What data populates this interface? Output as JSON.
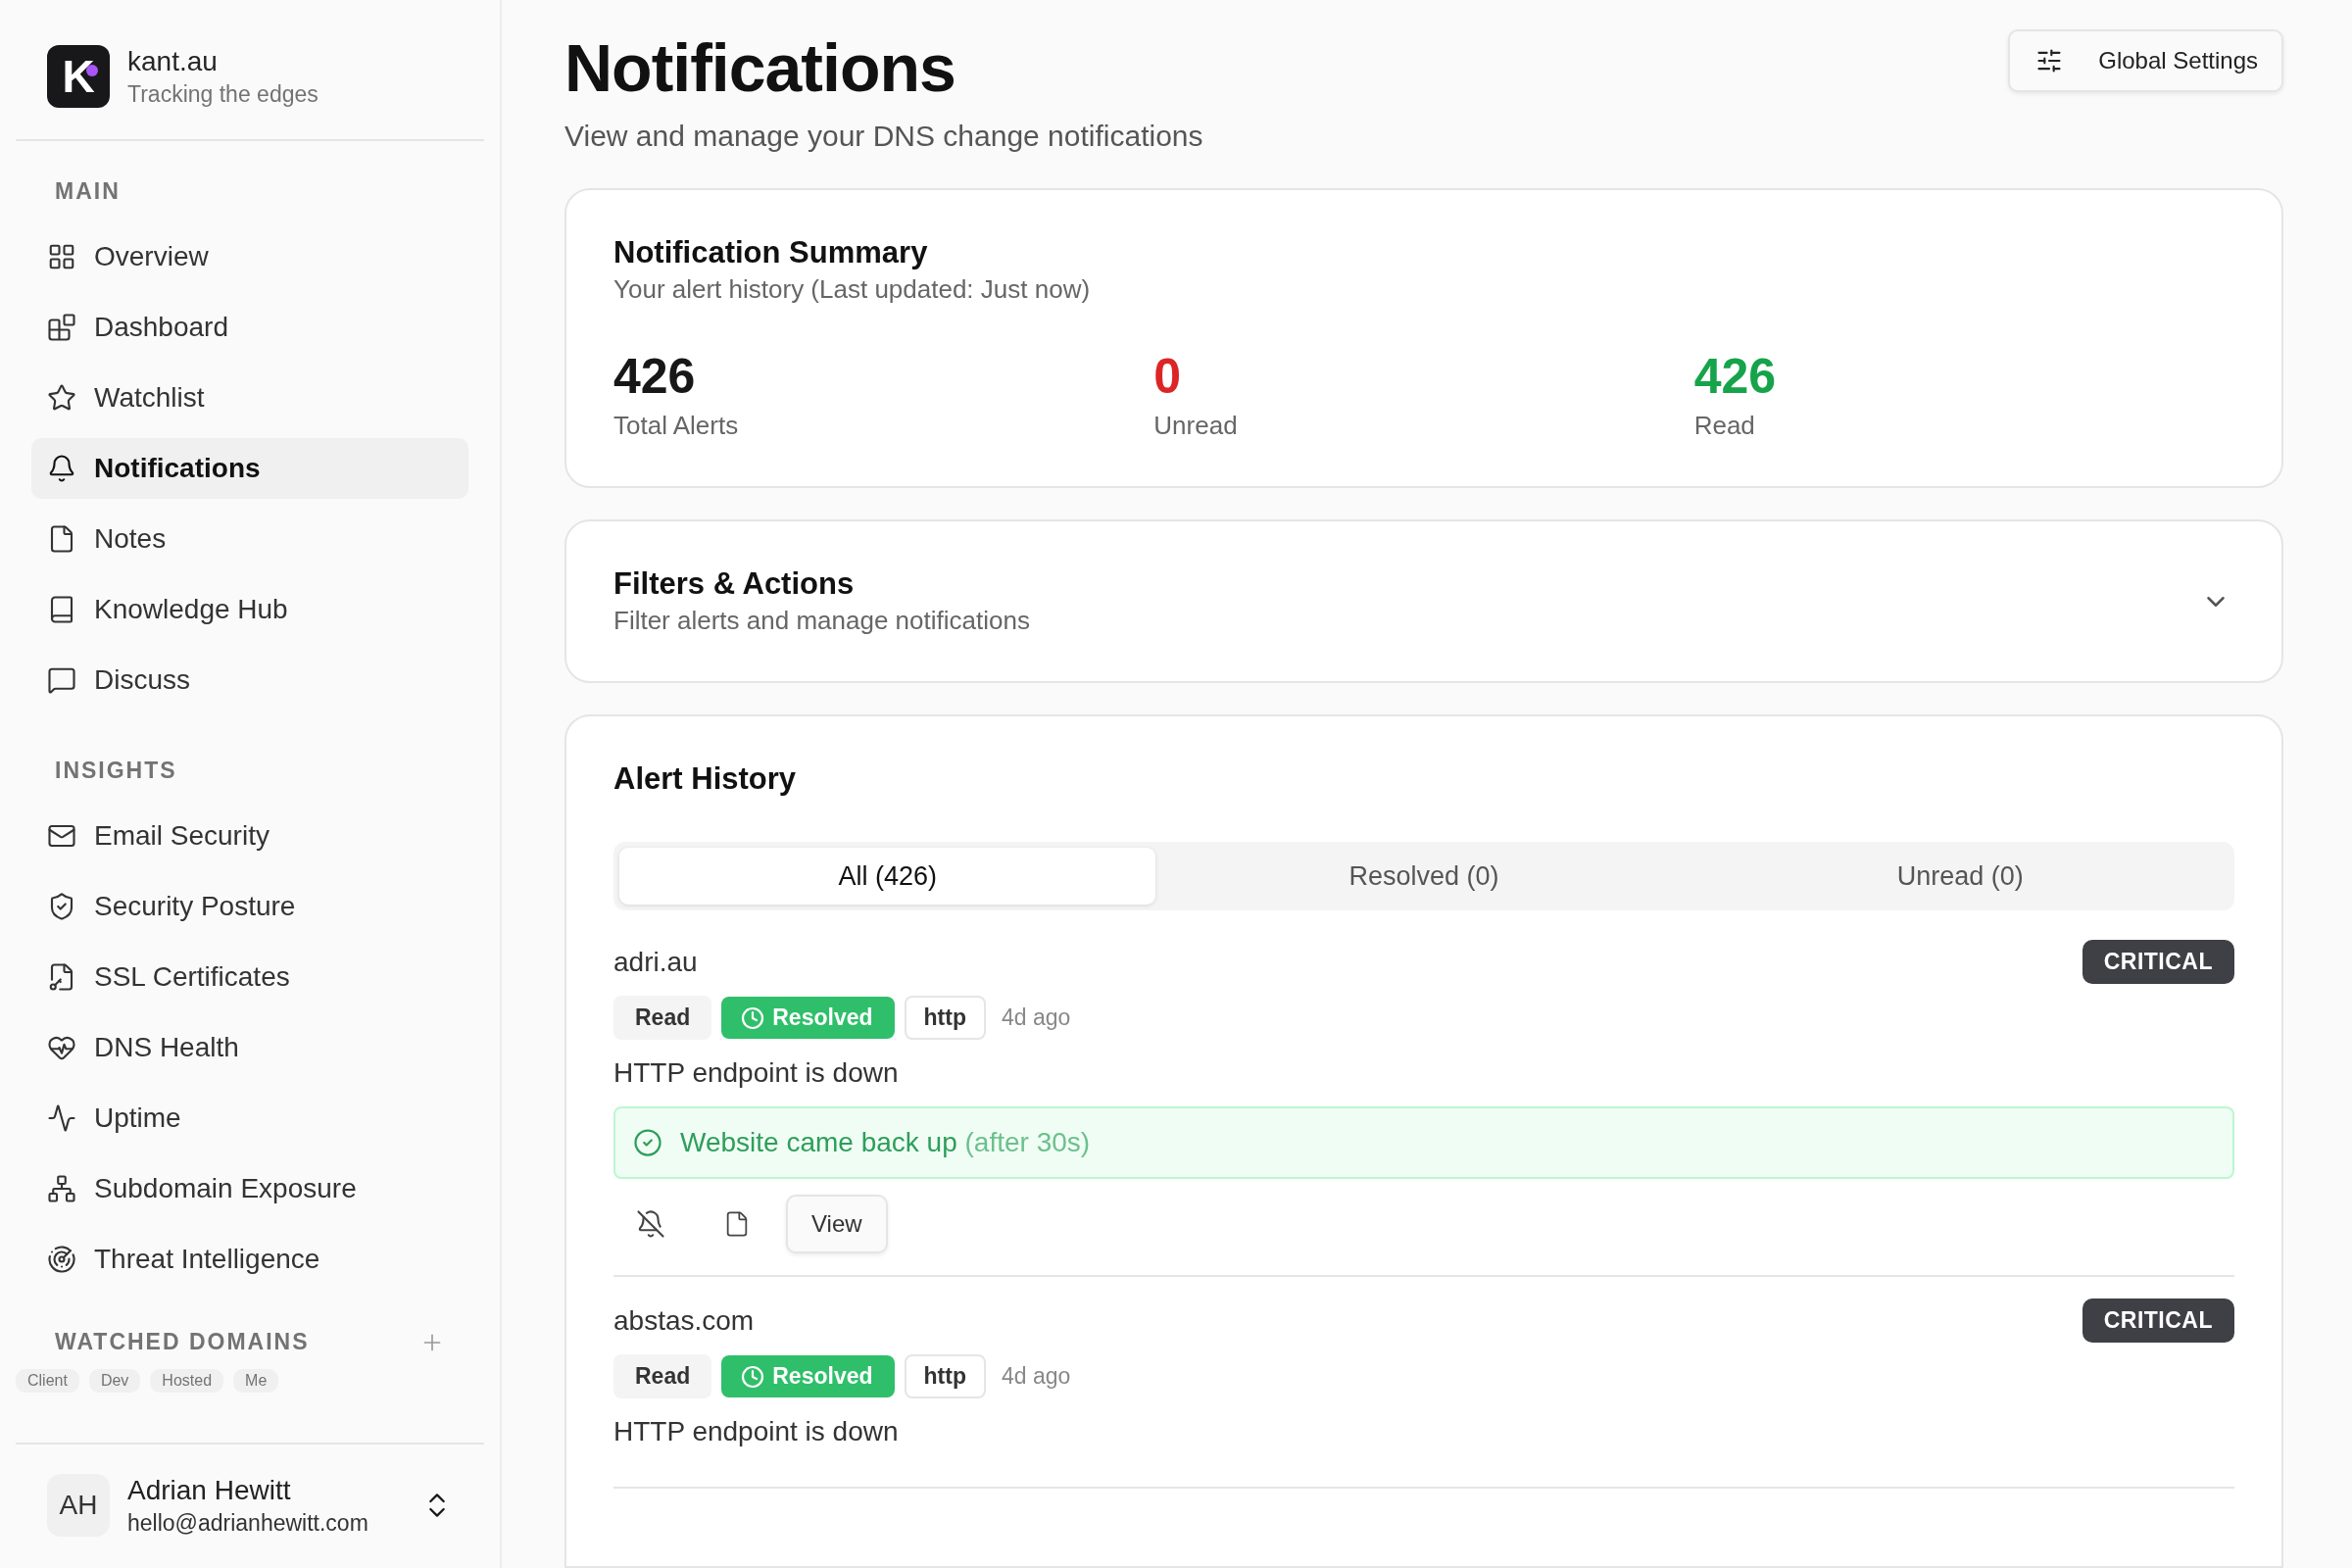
{
  "sidebar": {
    "brand": {
      "logo_letter": "K",
      "name": "kant.au",
      "tagline": "Tracking the edges"
    },
    "sections": [
      {
        "title": "MAIN",
        "items": [
          {
            "label": "Overview",
            "selected": false
          },
          {
            "label": "Dashboard",
            "selected": false
          },
          {
            "label": "Watchlist",
            "selected": false
          },
          {
            "label": "Notifications",
            "selected": true
          },
          {
            "label": "Notes",
            "selected": false
          },
          {
            "label": "Knowledge Hub",
            "selected": false
          },
          {
            "label": "Discuss",
            "selected": false
          }
        ]
      },
      {
        "title": "INSIGHTS",
        "items": [
          {
            "label": "Email Security",
            "selected": false
          },
          {
            "label": "Security Posture",
            "selected": false
          },
          {
            "label": "SSL Certificates",
            "selected": false
          },
          {
            "label": "DNS Health",
            "selected": false
          },
          {
            "label": "Uptime",
            "selected": false
          },
          {
            "label": "Subdomain Exposure",
            "selected": false
          },
          {
            "label": "Threat Intelligence",
            "selected": false
          }
        ]
      }
    ],
    "watched_domains": {
      "title": "WATCHED DOMAINS",
      "filters": [
        "Client",
        "Dev",
        "Hosted",
        "Me"
      ]
    },
    "user": {
      "initials": "AH",
      "name": "Adrian Hewitt",
      "email": "hello@adrianhewitt.com"
    }
  },
  "page": {
    "title": "Notifications",
    "subtitle": "View and manage your DNS change notifications",
    "settings_button": "Global Settings"
  },
  "summary": {
    "title": "Notification Summary",
    "subtitle": "Your alert history (Last updated: Just now)",
    "stats": [
      {
        "value": "426",
        "label": "Total Alerts",
        "color": "#171717"
      },
      {
        "value": "0",
        "label": "Unread",
        "color": "#dc2626"
      },
      {
        "value": "426",
        "label": "Read",
        "color": "#16a34a"
      }
    ]
  },
  "filters": {
    "title": "Filters & Actions",
    "subtitle": "Filter alerts and manage notifications",
    "expanded": false
  },
  "history": {
    "title": "Alert History",
    "tabs": [
      {
        "label": "All (426)",
        "selected": true
      },
      {
        "label": "Resolved (0)",
        "selected": false
      },
      {
        "label": "Unread (0)",
        "selected": false
      }
    ],
    "alerts": [
      {
        "domain": "adri.au",
        "severity": "CRITICAL",
        "read_state": "Read",
        "status": "Resolved",
        "type": "http",
        "time": "4d ago",
        "message": "HTTP endpoint is down",
        "resolution": {
          "text": "Website came back up",
          "detail": "(after 30s)"
        },
        "view_button": "View"
      },
      {
        "domain": "abstas.com",
        "severity": "CRITICAL",
        "read_state": "Read",
        "status": "Resolved",
        "type": "http",
        "time": "4d ago",
        "message": "HTTP endpoint is down"
      }
    ]
  }
}
